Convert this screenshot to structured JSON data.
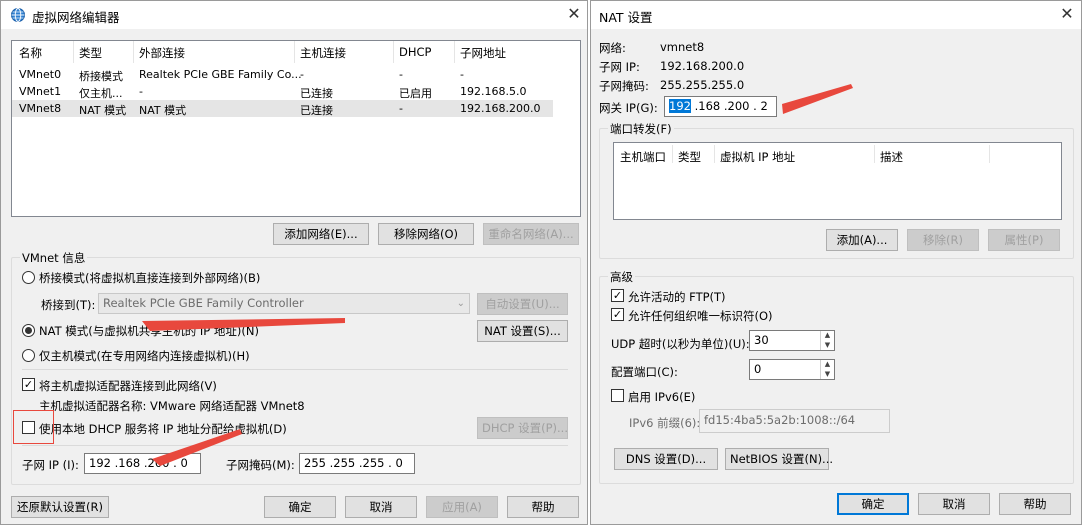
{
  "left_window": {
    "title": "虚拟网络编辑器",
    "close": "✕",
    "table": {
      "headers": [
        "名称",
        "类型",
        "外部连接",
        "主机连接",
        "DHCP",
        "子网地址"
      ],
      "rows": [
        [
          "VMnet0",
          "桥接模式",
          "Realtek PCIe GBE Family Co...",
          "-",
          "-",
          "-"
        ],
        [
          "VMnet1",
          "仅主机...",
          "-",
          "已连接",
          "已启用",
          "192.168.5.0"
        ],
        [
          "VMnet8",
          "NAT 模式",
          "NAT 模式",
          "已连接",
          "-",
          "192.168.200.0"
        ]
      ]
    },
    "buttons": {
      "add_network": "添加网络(E)...",
      "remove_network": "移除网络(O)",
      "rename_network": "重命名网络(A)..."
    },
    "vmnet_info": {
      "title": "VMnet 信息",
      "bridged": "桥接模式(将虚拟机直接连接到外部网络)(B)",
      "bridged_to_label": "桥接到(T):",
      "bridged_to_value": "Realtek PCIe GBE Family Controller",
      "auto_settings": "自动设置(U)...",
      "nat": "NAT 模式(与虚拟机共享主机的 IP 地址)(N)",
      "nat_settings": "NAT 设置(S)...",
      "host_only": "仅主机模式(在专用网络内连接虚拟机)(H)",
      "connect_host_adapter": "将主机虚拟适配器连接到此网络(V)",
      "host_adapter_name": "主机虚拟适配器名称: VMware 网络适配器 VMnet8",
      "use_dhcp": "使用本地 DHCP 服务将 IP 地址分配给虚拟机(D)",
      "dhcp_settings": "DHCP 设置(P)...",
      "subnet_ip_label": "子网 IP (I):",
      "subnet_ip_value": "192 .168 .200 .  0",
      "subnet_mask_label": "子网掩码(M):",
      "subnet_mask_value": "255 .255 .255 .  0"
    },
    "footer": {
      "restore_defaults": "还原默认设置(R)",
      "ok": "确定",
      "cancel": "取消",
      "apply": "应用(A)",
      "help": "帮助"
    }
  },
  "right_window": {
    "title": "NAT 设置",
    "close": "✕",
    "network_label": "网络:",
    "network_value": "vmnet8",
    "subnet_ip_label": "子网 IP:",
    "subnet_ip_value": "192.168.200.0",
    "subnet_mask_label": "子网掩码:",
    "subnet_mask_value": "255.255.255.0",
    "gateway_label": "网关 IP(G):",
    "gateway_first": "192",
    "gateway_rest": " .168 .200 .  2",
    "port_forwarding": {
      "title": "端口转发(F)",
      "headers": [
        "主机端口",
        "类型",
        "虚拟机 IP 地址",
        "描述"
      ],
      "add": "添加(A)...",
      "remove": "移除(R)",
      "properties": "属性(P)"
    },
    "advanced": {
      "title": "高级",
      "allow_ftp": "允许活动的 FTP(T)",
      "allow_any_oui": "允许任何组织唯一标识符(O)",
      "udp_timeout_label": "UDP 超时(以秒为单位)(U):",
      "udp_timeout_value": "30",
      "config_port_label": "配置端口(C):",
      "config_port_value": "0",
      "enable_ipv6": "启用 IPv6(E)",
      "ipv6_prefix_label": "IPv6 前缀(6):",
      "ipv6_prefix_value": "fd15:4ba5:5a2b:1008::/64",
      "dns_settings": "DNS 设置(D)...",
      "netbios_settings": "NetBIOS 设置(N)..."
    },
    "footer": {
      "ok": "确定",
      "cancel": "取消",
      "help": "帮助"
    }
  },
  "colors": {
    "window_bg": "#f0f0f0",
    "accent": "#0078d7",
    "annotation_red": "#e8483d"
  }
}
